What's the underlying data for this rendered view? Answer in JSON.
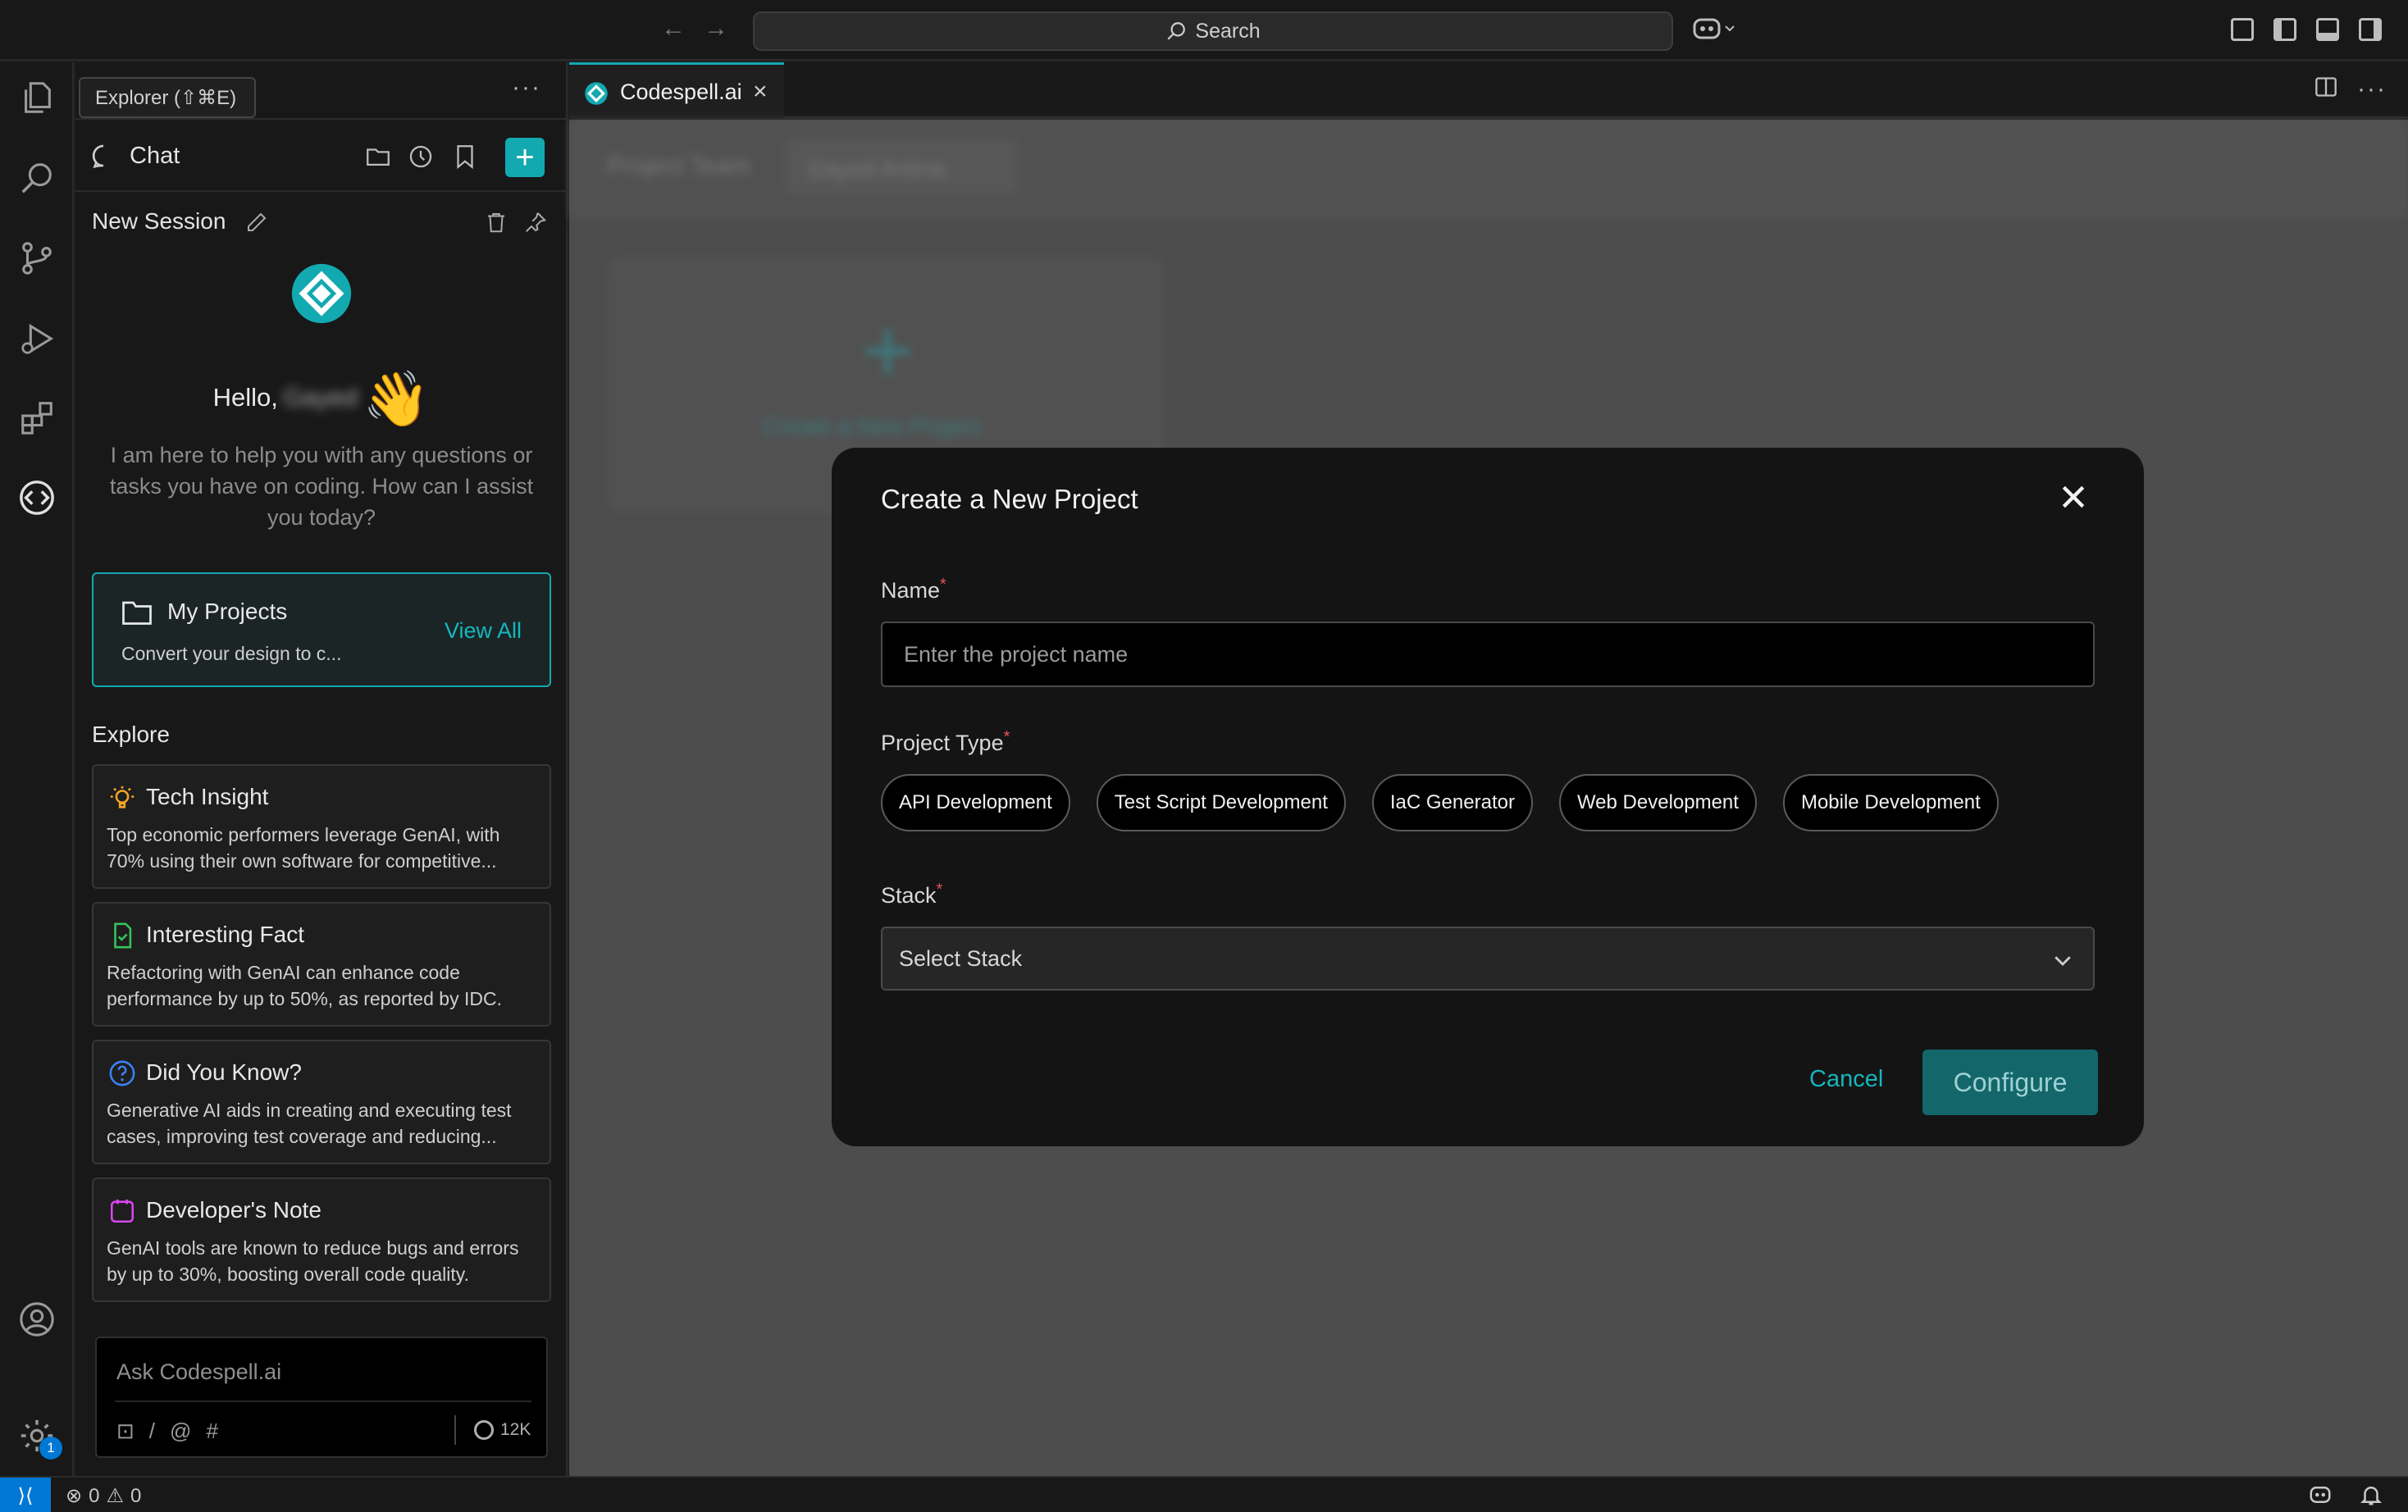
{
  "titlebar": {
    "search_label": "Search"
  },
  "activitybar": {
    "tooltip": "Explorer (⇧⌘E)",
    "settings_badge": "1"
  },
  "sidebar": {
    "more": "···",
    "chat_title": "Chat",
    "session_title": "New Session",
    "hello": "Hello,",
    "user_name": "Gayed",
    "intro": "I am here to help you with any questions or tasks you have on coding. How can I assist you today?",
    "projects": {
      "title": "My Projects",
      "subtitle": "Convert your design to c...",
      "view_all": "View All"
    },
    "explore_label": "Explore",
    "cards": [
      {
        "title": "Tech Insight",
        "text": "Top economic performers leverage GenAI, with 70% using their own software for competitive..."
      },
      {
        "title": "Interesting Fact",
        "text": "Refactoring with GenAI can enhance code performance by up to 50%, as reported by IDC."
      },
      {
        "title": "Did You Know?",
        "text": "Generative AI aids in creating and executing test cases, improving test coverage and reducing..."
      },
      {
        "title": "Developer's Note",
        "text": "GenAI tools are known to reduce bugs and errors by up to 30%, boosting overall code quality."
      }
    ],
    "ask": {
      "placeholder": "Ask Codespell.ai",
      "tools": [
        "⊡",
        "/",
        "@",
        "#"
      ],
      "token_count": "12K"
    }
  },
  "editor": {
    "tab_label": "Codespell.ai",
    "background": {
      "team_label": "Project Team",
      "team_value": "Gayed Antina",
      "create_card": "Create a New Project"
    }
  },
  "modal": {
    "title": "Create a New Project",
    "name_label": "Name",
    "name_placeholder": "Enter the project name",
    "type_label": "Project Type",
    "project_types": [
      "API Development",
      "Test Script Development",
      "IaC Generator",
      "Web Development",
      "Mobile Development"
    ],
    "stack_label": "Stack",
    "stack_value": "Select Stack",
    "cancel": "Cancel",
    "configure": "Configure",
    "required_mark": "*"
  },
  "statusbar": {
    "errors": "0",
    "warnings": "0"
  },
  "colors": {
    "accent": "#13a9b0",
    "required": "#e55353"
  }
}
